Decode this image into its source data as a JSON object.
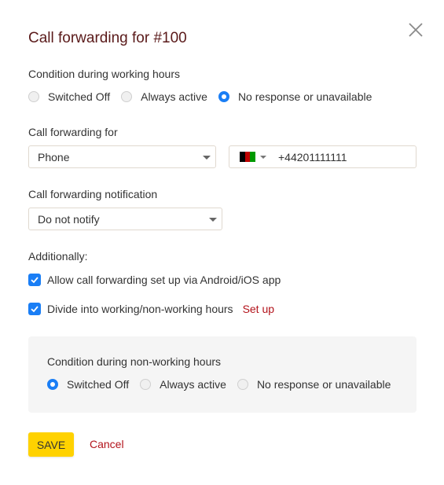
{
  "dialog": {
    "title": "Call forwarding for #100",
    "close_icon": "close-icon"
  },
  "working_hours": {
    "label": "Condition during working hours",
    "options": [
      {
        "label": "Switched Off",
        "selected": false
      },
      {
        "label": "Always active",
        "selected": false
      },
      {
        "label": "No response or unavailable",
        "selected": true
      }
    ]
  },
  "forwarding_for": {
    "label": "Call forwarding for",
    "type_value": "Phone",
    "country_flag": "Afghanistan",
    "phone_value": "+44201111111"
  },
  "notification": {
    "label": "Call forwarding notification",
    "value": "Do not notify"
  },
  "additionally": {
    "label": "Additionally:",
    "options": [
      {
        "label": "Allow call forwarding set up via Android/iOS app",
        "checked": true
      },
      {
        "label": "Divide into working/non-working hours",
        "checked": true
      }
    ],
    "setup_link": "Set up"
  },
  "non_working_hours": {
    "label": "Condition during non-working hours",
    "options": [
      {
        "label": "Switched Off",
        "selected": true
      },
      {
        "label": "Always active",
        "selected": false
      },
      {
        "label": "No response or unavailable",
        "selected": false
      }
    ]
  },
  "actions": {
    "save_label": "SAVE",
    "cancel_label": "Cancel"
  },
  "colors": {
    "accent_blue": "#1a7ef5",
    "save_yellow": "#ffd200",
    "link_red": "#b3131b",
    "title_color": "#5a1a1a"
  }
}
